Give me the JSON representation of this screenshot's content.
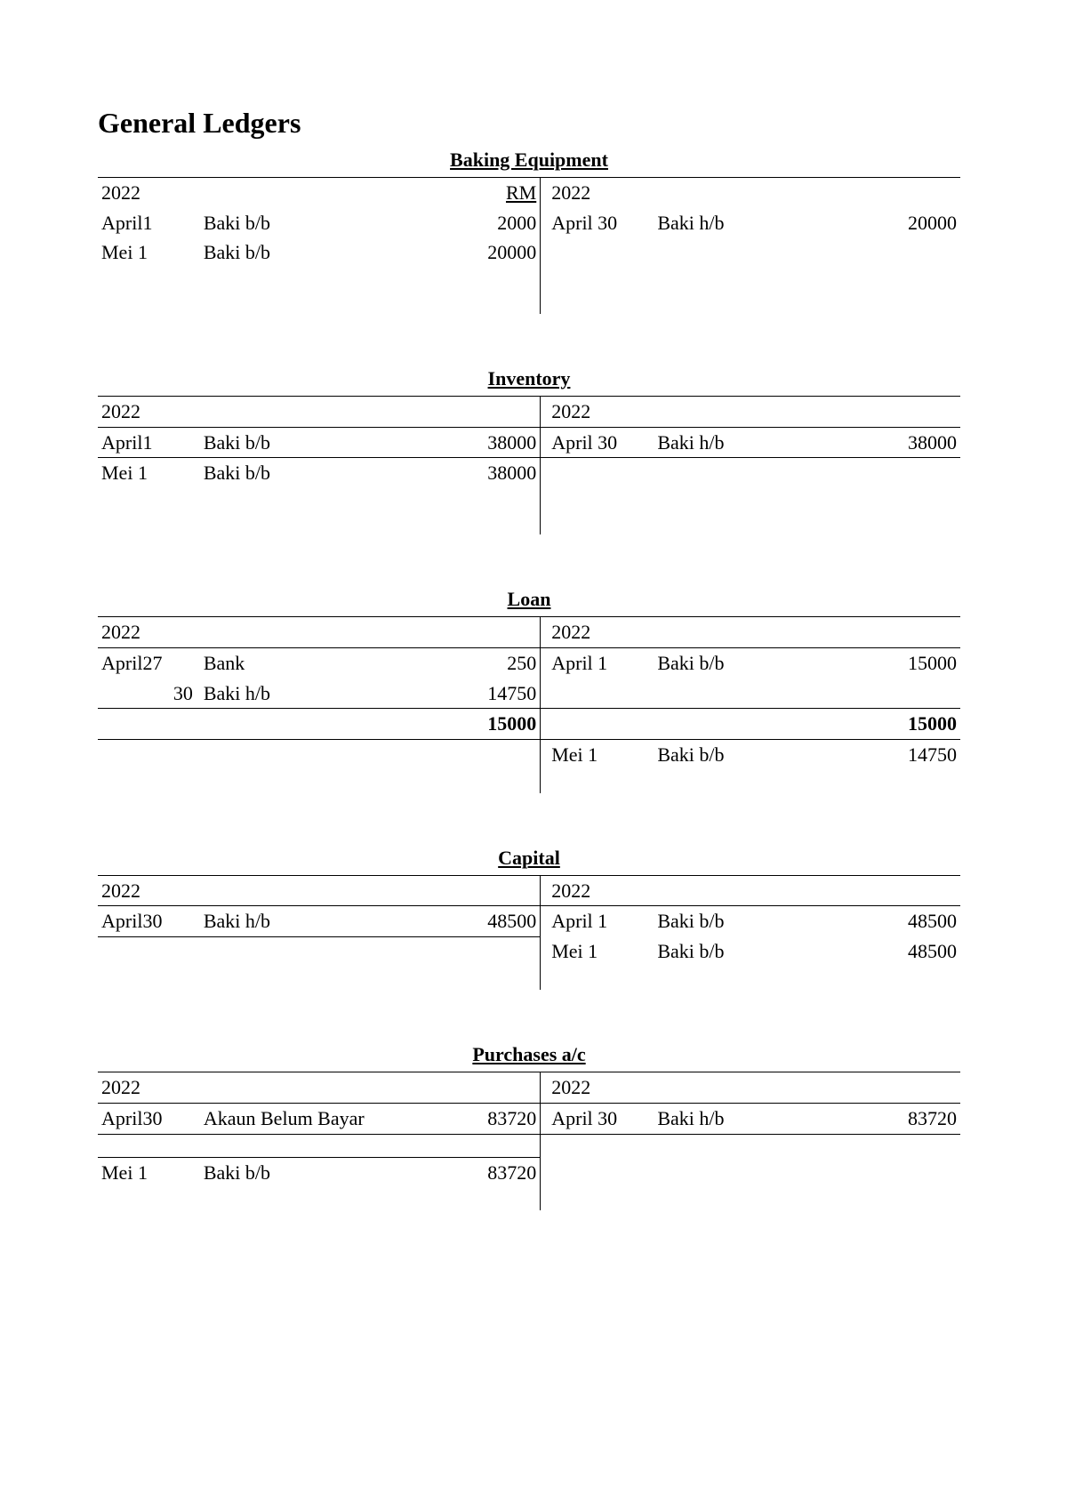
{
  "page_title": "General Ledgers",
  "currency_header": "RM",
  "year_label": "2022",
  "accounts": {
    "baking_equipment": {
      "title": "Baking Equipment",
      "debit": [
        {
          "date": "April1",
          "particulars": "Baki b/b",
          "amount": "2000"
        },
        {
          "date": "Mei  1",
          "particulars": "Baki b/b",
          "amount": "20000"
        }
      ],
      "credit": [
        {
          "date": "April 30",
          "particulars": "Baki h/b",
          "amount": "20000"
        }
      ]
    },
    "inventory": {
      "title": "Inventory",
      "debit": [
        {
          "date": "April1",
          "particulars": "Baki b/b",
          "amount": "38000"
        },
        {
          "date": "Mei  1",
          "particulars": "Baki b/b",
          "amount": "38000"
        }
      ],
      "credit": [
        {
          "date": "April 30",
          "particulars": "Baki h/b",
          "amount": "38000"
        }
      ]
    },
    "loan": {
      "title": "Loan",
      "debit": [
        {
          "date": "April27",
          "particulars": "Bank",
          "amount": "250"
        },
        {
          "date": "30",
          "particulars": "Baki h/b",
          "amount": "14750"
        }
      ],
      "credit": [
        {
          "date": "April 1",
          "particulars": "Baki b/b",
          "amount": "15000"
        }
      ],
      "debit_total": "15000",
      "credit_total": "15000",
      "credit_below": [
        {
          "date": "Mei 1",
          "particulars": "Baki b/b",
          "amount": "14750"
        }
      ]
    },
    "capital": {
      "title": "Capital",
      "debit": [
        {
          "date": "April30",
          "particulars": "Baki h/b",
          "amount": "48500"
        }
      ],
      "credit": [
        {
          "date": "April 1",
          "particulars": "Baki b/b",
          "amount": "48500"
        },
        {
          "date": "Mei 1",
          "particulars": "Baki b/b",
          "amount": "48500"
        }
      ]
    },
    "purchases": {
      "title": "Purchases a/c",
      "debit": [
        {
          "date": "April30",
          "particulars": "Akaun Belum Bayar",
          "amount": "83720"
        }
      ],
      "credit": [
        {
          "date": "April 30",
          "particulars": "Baki h/b",
          "amount": "83720"
        }
      ],
      "debit_below": [
        {
          "date": "Mei 1",
          "particulars": "Baki b/b",
          "amount": "83720"
        }
      ]
    }
  }
}
